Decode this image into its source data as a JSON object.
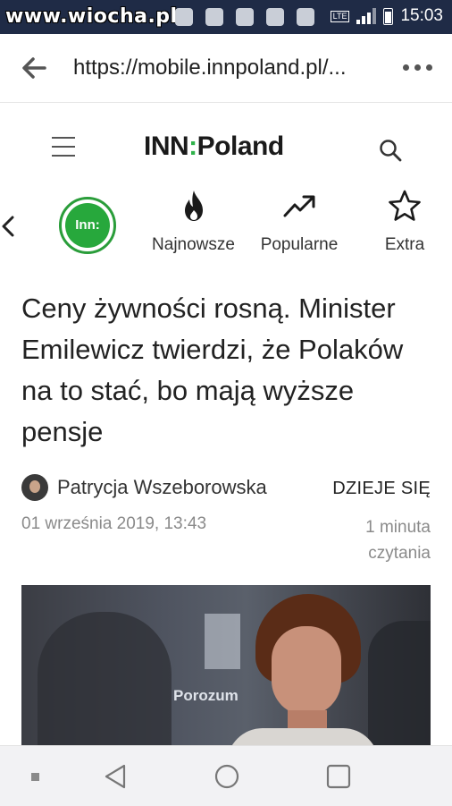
{
  "status_bar": {
    "watermark": "www.wiocha.pl",
    "network": "LTE",
    "time": "15:03"
  },
  "browser": {
    "url": "https://mobile.innpoland.pl/..."
  },
  "site": {
    "logo_part1": "INN",
    "logo_separator": ":",
    "logo_part2": "Poland",
    "brand_color": "#27a83c"
  },
  "categories": {
    "home_logo_text": "Inn:",
    "items": [
      {
        "label": "Najnowsze",
        "icon": "flame-icon"
      },
      {
        "label": "Popularne",
        "icon": "trending-up-icon"
      },
      {
        "label": "Extra",
        "icon": "star-icon"
      }
    ]
  },
  "article": {
    "title": "Ceny żywności rosną. Minister Emilewicz twierdzi, że Polaków na to stać, bo mają wyższe pensje",
    "author": "Patrycja Wszeborowska",
    "tag": "DZIEJE SIĘ",
    "date": "01 września 2019, 13:43",
    "read_time": "1 minuta czytania",
    "photo_sign_text": "Porozum"
  }
}
